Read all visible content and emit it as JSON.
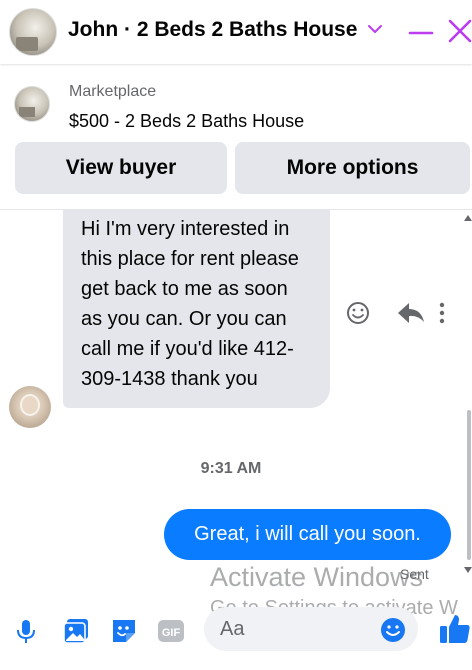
{
  "header": {
    "title": "John · 2 Beds 2 Baths House"
  },
  "marketplace": {
    "label": "Marketplace",
    "listing": "$500 - 2 Beds 2 Baths House",
    "view_buyer": "View buyer",
    "more_options": "More options"
  },
  "chat": {
    "incoming_message": "Hi I'm very interested in this place for rent please get back to me as soon as you can. Or you can call me if you'd like 412-309-1438 thank you",
    "timestamp": "9:31 AM",
    "outgoing_message": "Great, i will call you soon.",
    "sent_status": "Sent"
  },
  "watermark": {
    "line1": "Activate Windows",
    "line2": "Go to Settings to activate W"
  },
  "composer": {
    "placeholder": "Aa",
    "gif_label": "GIF"
  },
  "colors": {
    "accent": "#0a7cff",
    "icon_blue": "#1877f2",
    "close_purple": "#bc3cf0",
    "bubble_gray": "#e4e6eb"
  }
}
